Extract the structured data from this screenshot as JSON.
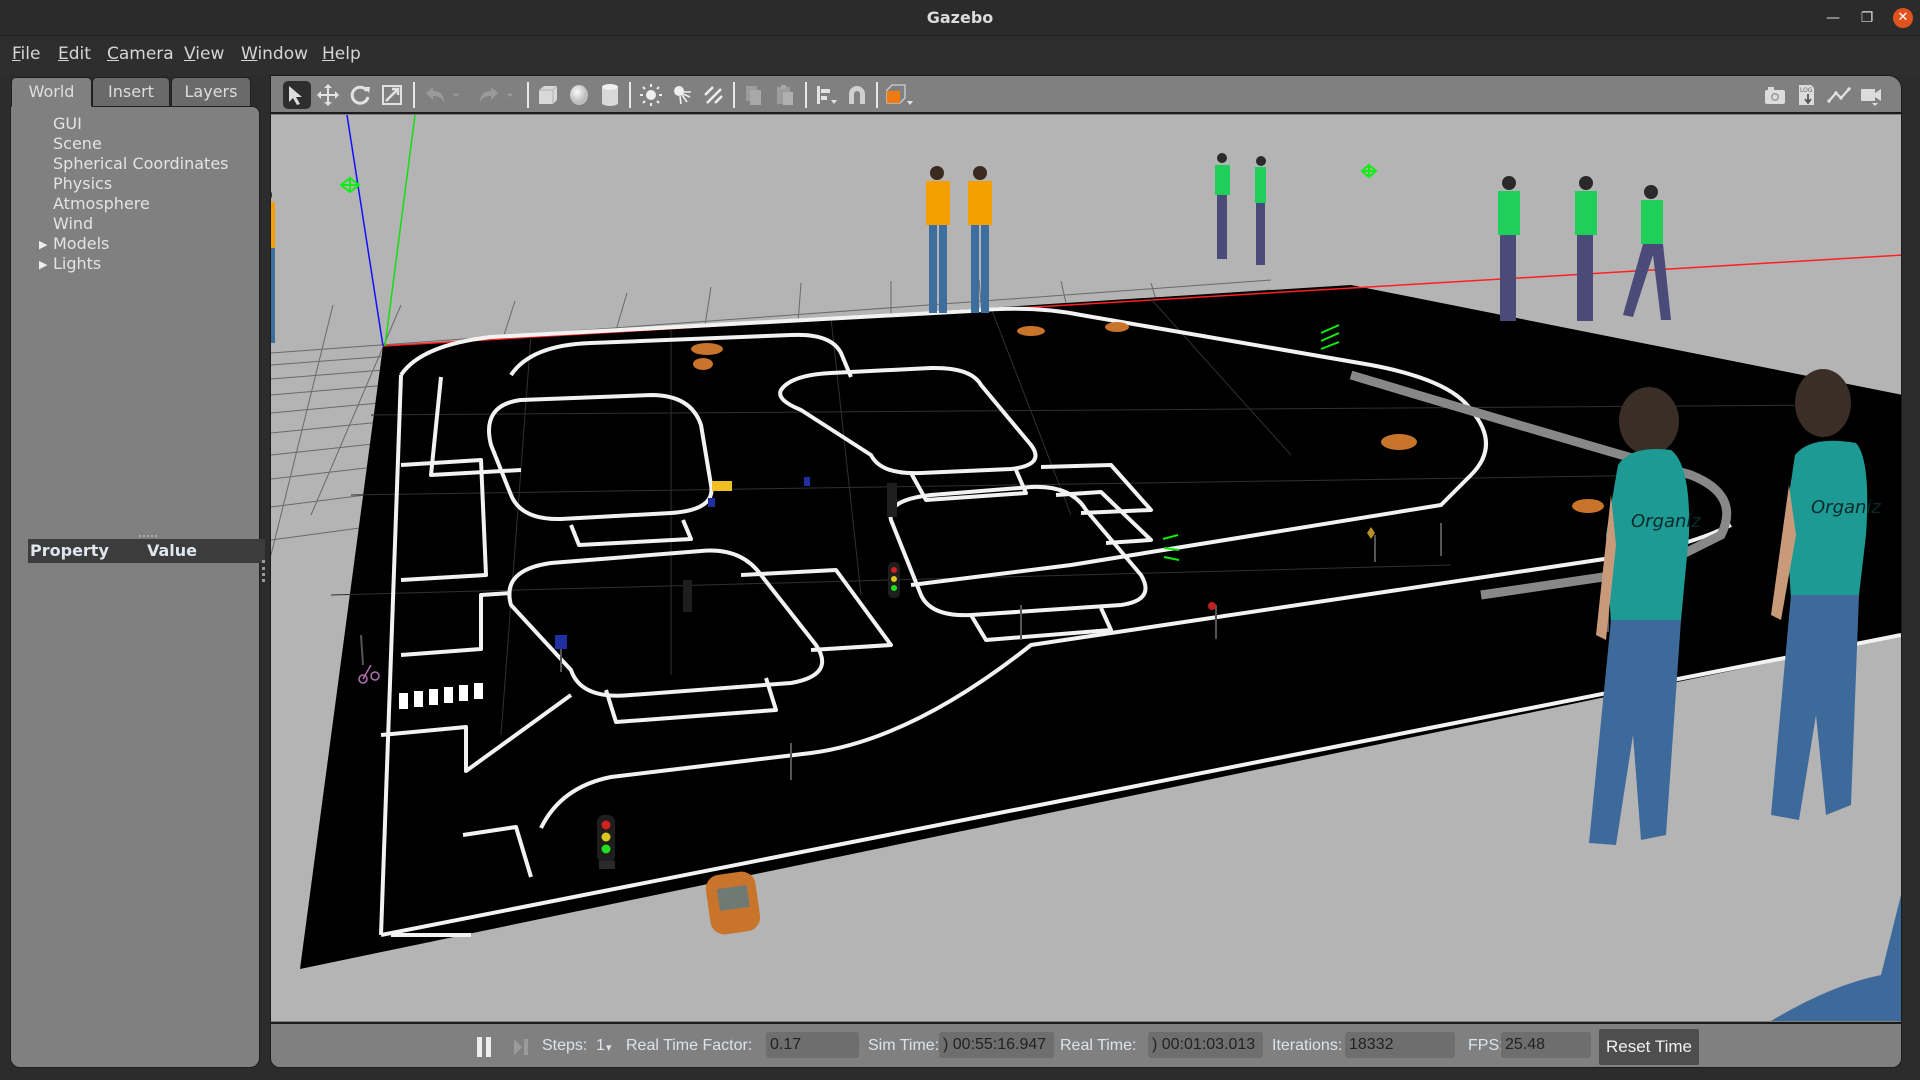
{
  "window": {
    "title": "Gazebo",
    "controls": [
      "minimize",
      "restore",
      "close"
    ]
  },
  "menubar": {
    "items": [
      {
        "label": "File",
        "mnemonic": "F"
      },
      {
        "label": "Edit",
        "mnemonic": "E"
      },
      {
        "label": "Camera",
        "mnemonic": "C"
      },
      {
        "label": "View",
        "mnemonic": "V"
      },
      {
        "label": "Window",
        "mnemonic": "W"
      },
      {
        "label": "Help",
        "mnemonic": "H"
      }
    ]
  },
  "left_panel": {
    "tabs": [
      {
        "label": "World",
        "active": true
      },
      {
        "label": "Insert",
        "active": false
      },
      {
        "label": "Layers",
        "active": false
      }
    ],
    "tree": [
      {
        "label": "GUI",
        "expandable": false
      },
      {
        "label": "Scene",
        "expandable": false
      },
      {
        "label": "Spherical Coordinates",
        "expandable": false
      },
      {
        "label": "Physics",
        "expandable": false
      },
      {
        "label": "Atmosphere",
        "expandable": false
      },
      {
        "label": "Wind",
        "expandable": false
      },
      {
        "label": "Models",
        "expandable": true
      },
      {
        "label": "Lights",
        "expandable": true
      }
    ],
    "property_table": {
      "headers": [
        "Property",
        "Value"
      ],
      "rows": []
    }
  },
  "toolbar": {
    "tools": [
      {
        "name": "select-mode",
        "icon": "arrow-cursor-icon",
        "active": true
      },
      {
        "name": "translate-mode",
        "icon": "move-arrows-icon",
        "active": false
      },
      {
        "name": "rotate-mode",
        "icon": "rotate-icon",
        "active": false
      },
      {
        "name": "scale-mode",
        "icon": "scale-icon",
        "active": false
      },
      {
        "name": "undo",
        "icon": "undo-icon",
        "active": false
      },
      {
        "name": "undo-history",
        "icon": "dropdown-icon",
        "active": false
      },
      {
        "name": "redo",
        "icon": "redo-icon",
        "active": false
      },
      {
        "name": "redo-history",
        "icon": "dropdown-icon",
        "active": false
      },
      {
        "name": "box-shape",
        "icon": "box-icon",
        "active": false
      },
      {
        "name": "sphere-shape",
        "icon": "sphere-icon",
        "active": false
      },
      {
        "name": "cylinder-shape",
        "icon": "cylinder-icon",
        "active": false
      },
      {
        "name": "point-light",
        "icon": "point-light-icon",
        "active": false
      },
      {
        "name": "spot-light",
        "icon": "spot-light-icon",
        "active": false
      },
      {
        "name": "directional-light",
        "icon": "directional-light-icon",
        "active": false
      },
      {
        "name": "copy",
        "icon": "copy-icon",
        "active": false
      },
      {
        "name": "paste",
        "icon": "paste-icon",
        "active": false
      },
      {
        "name": "align",
        "icon": "align-icon",
        "active": false
      },
      {
        "name": "snap",
        "icon": "magnet-icon",
        "active": false
      },
      {
        "name": "view-angle",
        "icon": "view-cube-icon",
        "active": false
      }
    ],
    "right_tools": [
      {
        "name": "screenshot",
        "icon": "camera-icon"
      },
      {
        "name": "log",
        "icon": "log-icon",
        "text": "LOG"
      },
      {
        "name": "plot",
        "icon": "plot-icon"
      },
      {
        "name": "video-record",
        "icon": "video-camera-icon"
      }
    ]
  },
  "scene": {
    "background_color": "#b4b4b4",
    "ground_color": "#000000",
    "lane_color": "#ffffff",
    "axis_colors": {
      "x": "#ff0000",
      "y": "#00ff00",
      "z": "#0000ff"
    },
    "pedestrians": [
      {
        "shirt": "orange",
        "color": "#f5a000"
      },
      {
        "shirt": "orange",
        "color": "#f5a000"
      },
      {
        "shirt": "orange",
        "color": "#f5a000"
      },
      {
        "shirt": "green",
        "color": "#1fcf5a"
      },
      {
        "shirt": "green",
        "color": "#1fcf5a"
      },
      {
        "shirt": "green",
        "color": "#1fcf5a"
      },
      {
        "shirt": "green",
        "color": "#1fcf5a"
      },
      {
        "shirt": "green",
        "color": "#1fcf5a"
      },
      {
        "shirt": "teal",
        "color": "#1e9a94",
        "print": "Organiz"
      },
      {
        "shirt": "teal",
        "color": "#1e9a94",
        "print": "Organiz"
      }
    ],
    "vehicle_color": "#c8742a",
    "traffic_light_colors": [
      "#d22020",
      "#d8c820",
      "#20e020"
    ]
  },
  "bottombar": {
    "pause_icon": "pause-icon",
    "step_icon": "step-icon",
    "steps_label": "Steps:",
    "steps_value": "1",
    "rtf_label": "Real Time Factor:",
    "rtf_value": "0.17",
    "sim_time_label": "Sim Time:",
    "sim_time_value": ") 00:55:16.947",
    "real_time_label": "Real Time:",
    "real_time_value": ") 00:01:03.013",
    "iterations_label": "Iterations:",
    "iterations_value": "18332",
    "fps_label": "FPS:",
    "fps_value": "25.48",
    "reset_time_label": "Reset Time"
  }
}
